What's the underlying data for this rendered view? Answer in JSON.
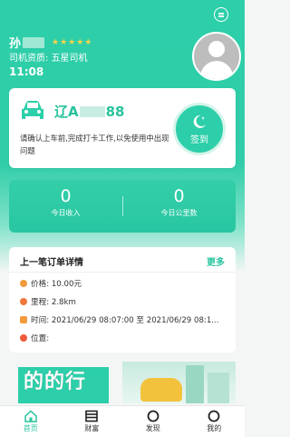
{
  "driver": {
    "name": "孙",
    "stars": "★★★★★",
    "qualification": "司机资质:  五星司机",
    "time": "11:08"
  },
  "vehicle": {
    "plate_prefix": "辽A",
    "plate_suffix": "88",
    "notice": "请确认上车前,完成打卡工作,以免使用中出现问题",
    "signin_label": "签到"
  },
  "stats": {
    "income_value": "0",
    "income_label": "今日收入",
    "distance_value": "0",
    "distance_label": "今日公里数"
  },
  "last_order": {
    "title": "上一笔订单详情",
    "more_label": "更多",
    "price": "价格:  10.00元",
    "mileage": "里程:  2.8km",
    "time": "时间:  2021/06/29 08:07:00 至 2021/06/29 08:1...",
    "location": "位置:"
  },
  "banner": {
    "text": "的的行"
  },
  "tabs": [
    {
      "label": "首页"
    },
    {
      "label": "财富"
    },
    {
      "label": "发现"
    },
    {
      "label": "我的"
    }
  ],
  "colors": {
    "accent": "#2ccfa9",
    "accent_text": "#27c39d",
    "star": "#f7d54b"
  }
}
